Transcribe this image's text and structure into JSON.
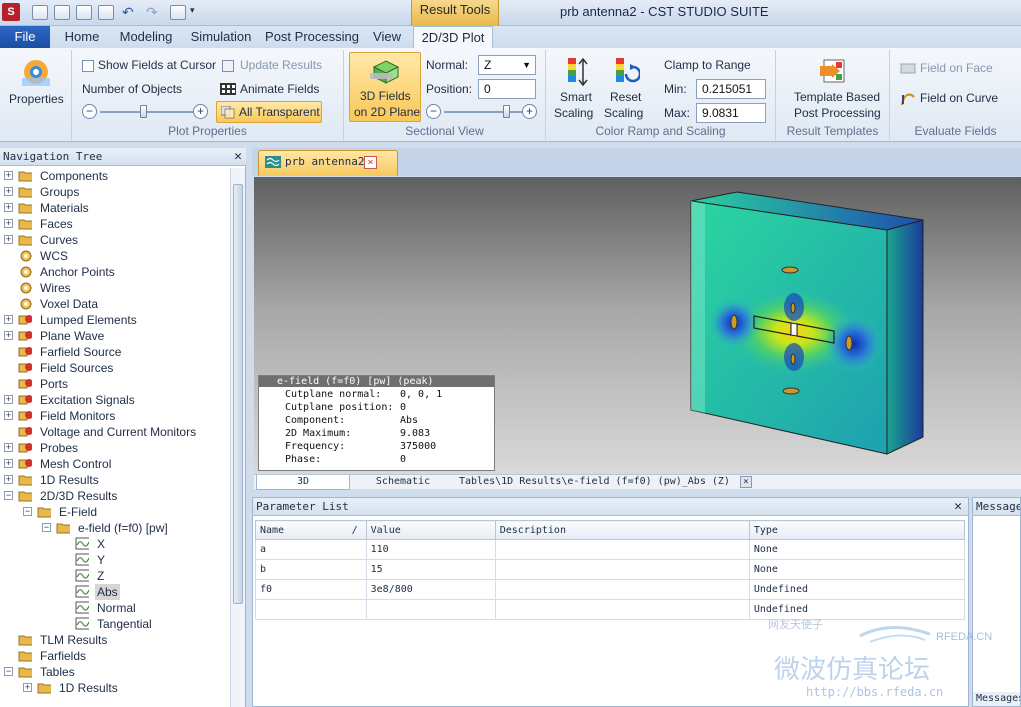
{
  "window": {
    "title": "prb antenna2 - CST STUDIO SUITE",
    "context_tab_title": "Result Tools"
  },
  "tabs": {
    "file": "File",
    "items": [
      {
        "label": "Home"
      },
      {
        "label": "Modeling"
      },
      {
        "label": "Simulation"
      },
      {
        "label": "Post Processing"
      },
      {
        "label": "View"
      },
      {
        "label": "2D/3D Plot"
      }
    ]
  },
  "ribbon": {
    "properties": "Properties",
    "show_fields_at_cursor": "Show Fields at Cursor",
    "update_results": "Update Results",
    "number_of_objects": "Number of Objects",
    "animate_fields": "Animate Fields",
    "all_transparent": "All Transparent",
    "plot_properties": "Plot Properties",
    "fields_on_plane_line1": "3D Fields",
    "fields_on_plane_line2": "on 2D Plane",
    "normal_label": "Normal:",
    "normal_value": "Z",
    "position_label": "Position:",
    "position_value": "0",
    "sectional_view": "Sectional View",
    "smart_scaling_line1": "Smart",
    "smart_scaling_line2": "Scaling",
    "reset_scaling_line1": "Reset",
    "reset_scaling_line2": "Scaling",
    "clamp_to_range": "Clamp to Range",
    "min_label": "Min:",
    "min_value": "0.215051",
    "max_label": "Max:",
    "max_value": "9.0831",
    "color_ramp": "Color Ramp and Scaling",
    "template_line1": "Template Based",
    "template_line2": "Post Processing",
    "result_templates": "Result Templates",
    "field_on_face": "Field on Face",
    "field_on_curve": "Field on Curve",
    "evaluate_fields": "Evaluate Fields"
  },
  "nav": {
    "title": "Navigation Tree",
    "items": [
      {
        "label": "Components"
      },
      {
        "label": "Groups"
      },
      {
        "label": "Materials"
      },
      {
        "label": "Faces"
      },
      {
        "label": "Curves"
      },
      {
        "label": "WCS"
      },
      {
        "label": "Anchor Points"
      },
      {
        "label": "Wires"
      },
      {
        "label": "Voxel Data"
      },
      {
        "label": "Lumped Elements"
      },
      {
        "label": "Plane Wave"
      },
      {
        "label": "Farfield Source"
      },
      {
        "label": "Field Sources"
      },
      {
        "label": "Ports"
      },
      {
        "label": "Excitation Signals"
      },
      {
        "label": "Field Monitors"
      },
      {
        "label": "Voltage and Current Monitors"
      },
      {
        "label": "Probes"
      },
      {
        "label": "Mesh Control"
      },
      {
        "label": "1D Results"
      },
      {
        "label": "2D/3D Results"
      },
      {
        "label": "E-Field"
      },
      {
        "label": "e-field (f=f0) [pw]"
      },
      {
        "label": "X"
      },
      {
        "label": "Y"
      },
      {
        "label": "Z"
      },
      {
        "label": "Abs"
      },
      {
        "label": "Normal"
      },
      {
        "label": "Tangential"
      },
      {
        "label": "TLM Results"
      },
      {
        "label": "Farfields"
      },
      {
        "label": "Tables"
      },
      {
        "label": "1D Results"
      }
    ]
  },
  "doc": {
    "tab_title": "prb antenna2",
    "close": "×"
  },
  "legend": {
    "title": "e-field (f=f0) [pw] (peak)",
    "rows": [
      {
        "label": "Cutplane normal:",
        "value": "0, 0, 1"
      },
      {
        "label": "Cutplane position:",
        "value": "0"
      },
      {
        "label": "Component:",
        "value": "Abs"
      },
      {
        "label": "2D Maximum:",
        "value": "9.083"
      },
      {
        "label": "Frequency:",
        "value": "375000"
      },
      {
        "label": "Phase:",
        "value": "0"
      }
    ]
  },
  "view_tabs": {
    "t3d": "3D",
    "schematic": "Schematic",
    "result_path": "Tables\\1D Results\\e-field (f=f0) (pw)_Abs (Z)",
    "close": "×"
  },
  "params": {
    "title": "Parameter List",
    "columns": {
      "name": "Name",
      "sort": "/",
      "value": "Value",
      "description": "Description",
      "type": "Type"
    },
    "rows": [
      {
        "name": "a",
        "value": "110",
        "description": "",
        "type": "None"
      },
      {
        "name": "b",
        "value": "15",
        "description": "",
        "type": "None"
      },
      {
        "name": "f0",
        "value": "3e8/800",
        "description": "",
        "type": "Undefined"
      },
      {
        "name": "",
        "value": "",
        "description": "",
        "type": "Undefined"
      }
    ]
  },
  "messages": {
    "title": "Messages",
    "footer": "Messages"
  },
  "watermark": {
    "line1": "网友天使子",
    "brand": "RFEDA.CN",
    "line2": "微波仿真论坛",
    "url": "http://bbs.rfeda.cn"
  }
}
